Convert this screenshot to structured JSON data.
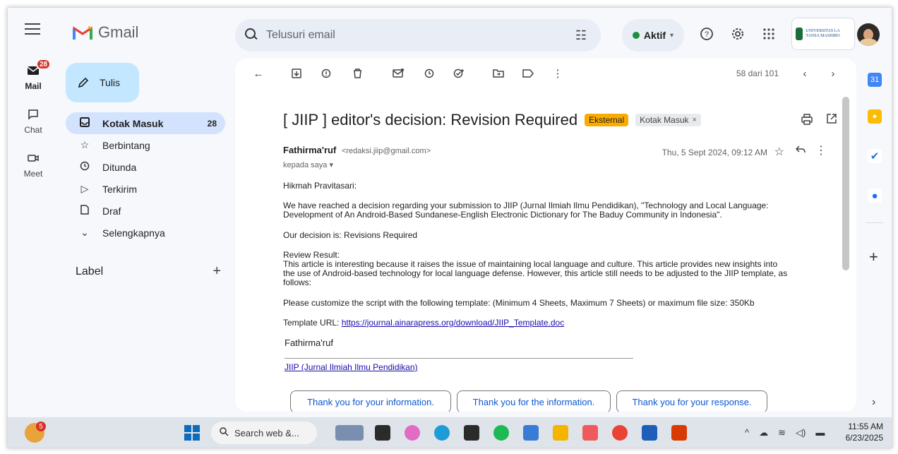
{
  "app": {
    "name": "Gmail"
  },
  "search": {
    "placeholder": "Telusuri email"
  },
  "status": {
    "label": "Aktif"
  },
  "org": {
    "name": "UNIVERSITAS LA TANSA MASHIRO"
  },
  "rail": {
    "mail": {
      "label": "Mail",
      "badge": "28"
    },
    "chat": {
      "label": "Chat"
    },
    "meet": {
      "label": "Meet"
    }
  },
  "compose": {
    "label": "Tulis"
  },
  "nav": [
    {
      "label": "Kotak Masuk",
      "count": "28",
      "icon": "inbox-icon"
    },
    {
      "label": "Berbintang",
      "icon": "star-icon"
    },
    {
      "label": "Ditunda",
      "icon": "clock-icon"
    },
    {
      "label": "Terkirim",
      "icon": "send-icon"
    },
    {
      "label": "Draf",
      "icon": "draft-icon"
    },
    {
      "label": "Selengkapnya",
      "icon": "chevron-down-icon"
    }
  ],
  "labels": {
    "title": "Label"
  },
  "pager": {
    "text": "58 dari 101"
  },
  "email": {
    "subject": "[ JIIP ] editor's decision: Revision Required",
    "tag_external": "Eksternal",
    "tag_inbox": "Kotak Masuk",
    "sender_name": "Fathirma'ruf",
    "sender_email": "<redaksi.jiip@gmail.com>",
    "recipient": "kepada saya",
    "date": "Thu, 5 Sept 2024, 09:12 AM",
    "greeting": "Hikmah Pravitasari:",
    "p1": "We have reached a decision regarding your submission to JIIP (Jurnal Ilmiah Ilmu Pendidikan), \"Technology and Local Language: Development of An Android-Based Sundanese-English Electronic Dictionary for The Baduy Community in Indonesia\".",
    "p2": "Our decision is: Revisions Required",
    "p3_title": "Review Result:",
    "p3": "This article is interesting because it raises the issue of maintaining local language and culture. This article provides new insights into the use of Android-based technology for local language defense. However, this article still needs to be adjusted to the JIIP template, as follows:",
    "p4": "Please customize the script with the following template:  (Minimum 4 Sheets, Maximum 7 Sheets) or maximum file size: 350Kb",
    "p5_label": "Template URL: ",
    "p5_link": "https://journal.ainarapress.org/download/JIIP_Template.doc",
    "signature": "Fathirma'ruf",
    "sig_link": "JIIP (Jurnal Ilmiah Ilmu Pendidikan)"
  },
  "smart_replies": [
    "Thank you for your information.",
    "Thank you for the information.",
    "Thank you for your response."
  ],
  "taskbar": {
    "notify_badge": "5",
    "search_placeholder": "Search web &...",
    "time": "11:55 AM",
    "date": "6/23/2025"
  }
}
